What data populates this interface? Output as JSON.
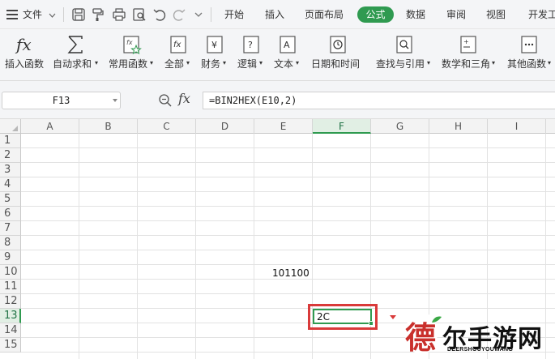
{
  "menubar": {
    "file_label": "文件",
    "tabs": [
      {
        "label": "开始"
      },
      {
        "label": "插入"
      },
      {
        "label": "页面布局"
      },
      {
        "label": "公式",
        "active": true
      },
      {
        "label": "数据"
      },
      {
        "label": "审阅"
      },
      {
        "label": "视图"
      },
      {
        "label": "开发工"
      }
    ],
    "quick_icons": [
      "save-icon",
      "format-painter-icon",
      "print-icon",
      "print-preview-icon",
      "undo-icon",
      "redo-icon",
      "more-icon"
    ],
    "accent_color": "#2f9a50"
  },
  "ribbon": {
    "buttons": [
      {
        "label": "插入函数",
        "icon": "fx-icon"
      },
      {
        "label": "自动求和",
        "icon": "sigma-icon",
        "dropdown": true
      },
      {
        "label": "常用函数",
        "icon": "star-function-icon",
        "dropdown": true
      },
      {
        "label": "全部",
        "icon": "fx-box-icon",
        "dropdown": true
      },
      {
        "label": "财务",
        "icon": "finance-icon",
        "dropdown": true
      },
      {
        "label": "逻辑",
        "icon": "logic-icon",
        "dropdown": true
      },
      {
        "label": "文本",
        "icon": "text-icon",
        "dropdown": true
      },
      {
        "label": "日期和时间",
        "icon": "clock-icon",
        "dropdown": true
      },
      {
        "label": "查找与引用",
        "icon": "lookup-icon",
        "dropdown": true
      },
      {
        "label": "数学和三角",
        "icon": "math-icon",
        "dropdown": true
      },
      {
        "label": "其他函数",
        "icon": "more-functions-icon",
        "dropdown": true
      }
    ]
  },
  "formula_bar": {
    "name_box": "F13",
    "fx_label": "fx",
    "formula": "=BIN2HEX(E10,2)"
  },
  "sheet": {
    "columns": [
      "A",
      "B",
      "C",
      "D",
      "E",
      "F",
      "G",
      "H",
      "I"
    ],
    "rows": [
      "1",
      "2",
      "3",
      "4",
      "5",
      "6",
      "7",
      "8",
      "9",
      "10",
      "11",
      "12",
      "13",
      "14",
      "15"
    ],
    "active_column": "F",
    "active_row": "13",
    "cells": {
      "E10": "101100",
      "F13": "2C"
    }
  },
  "watermark": {
    "main": "德",
    "rest": "尔手游网",
    "sub": "DEERSHOUYOUWANG"
  }
}
